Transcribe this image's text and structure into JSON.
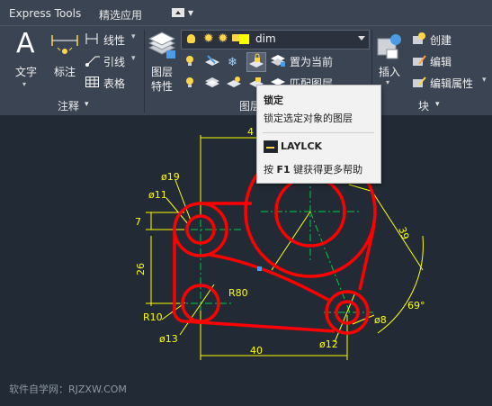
{
  "menubar": {
    "express_tools": "Express Tools",
    "quick_select": "精选应用",
    "dropdown_arrow": "▾"
  },
  "ribbon": {
    "annotation": {
      "text_label": "文字",
      "dimension_label": "标注",
      "linear_label": "线性",
      "leader_label": "引线",
      "table_label": "表格",
      "panel_title": "注释"
    },
    "layers": {
      "layer_props_label_line1": "图层",
      "layer_props_label_line2": "特性",
      "current_layer": "dim",
      "current_layer_color": "#ffff00",
      "set_current_label": "置为当前",
      "match_layer_label": "匹配图层",
      "panel_title": "图层"
    },
    "block": {
      "insert_label": "插入",
      "create_label": "创建",
      "edit_label": "编辑",
      "edit_attributes_label": "编辑属性",
      "panel_title": "块"
    }
  },
  "tooltip": {
    "title": "锁定",
    "description": "锁定选定对象的图层",
    "command": "LAYLCK",
    "help_prefix": "按",
    "help_key": "F1",
    "help_suffix": "键获得更多帮助"
  },
  "drawing": {
    "dims": {
      "top_width": "4",
      "left_offset": "7",
      "left_height": "26",
      "bottom_width": "40",
      "diagonal": "39",
      "angle": "69°",
      "d19": "ø19",
      "d11": "ø11",
      "d13": "ø13",
      "d12": "ø12",
      "d8": "ø8",
      "r10": "R10",
      "r80": "R80"
    },
    "colors": {
      "outline": "#ff0000",
      "dimension": "#ffff00",
      "centerline": "#00cc44",
      "background": "#222b35"
    }
  },
  "watermark": "软件自学网：RJZXW.COM"
}
